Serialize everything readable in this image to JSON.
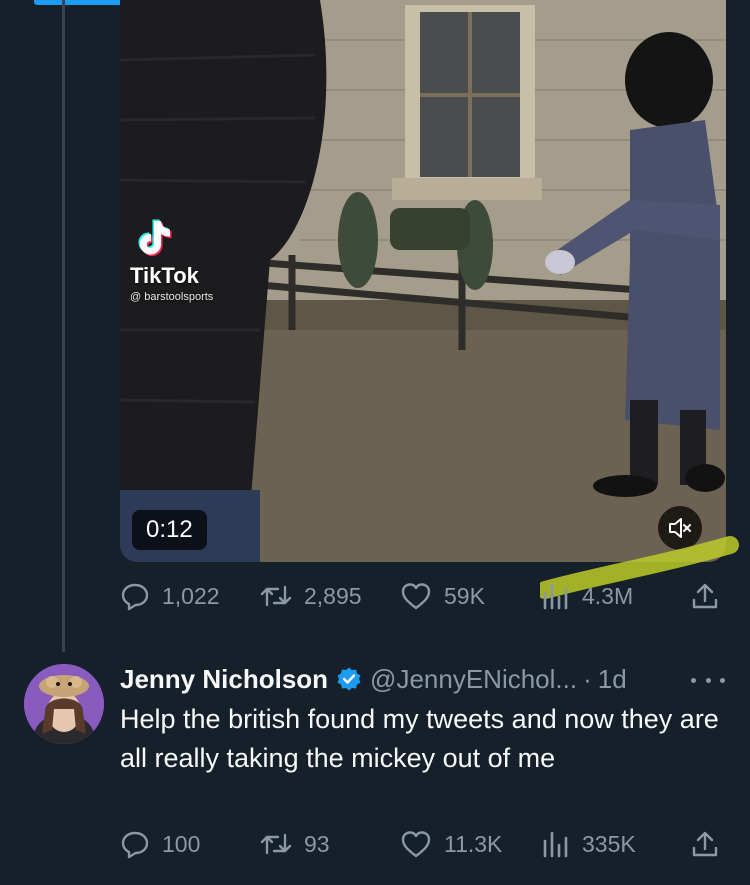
{
  "video": {
    "watermark_brand": "TikTok",
    "watermark_handle": "@ barstoolsports",
    "duration": "0:12",
    "mute_icon": "speaker-muted-icon"
  },
  "quoted_tweet_actions": {
    "replies": "1,022",
    "retweets": "2,895",
    "likes": "59K",
    "views": "4.3M"
  },
  "reply_tweet": {
    "author_name": "Jenny Nicholson",
    "handle": "@JennyENichol...",
    "separator": "·",
    "time": "1d",
    "text": "Help the british found my tweets and now they are all really taking the mickey out of me",
    "actions": {
      "replies": "100",
      "retweets": "93",
      "likes": "11.3K",
      "views": "335K"
    }
  },
  "colors": {
    "background": "#15202b",
    "muted_text": "#8b98a5",
    "accent": "#1d9bf0",
    "thread_line": "#38444d"
  }
}
